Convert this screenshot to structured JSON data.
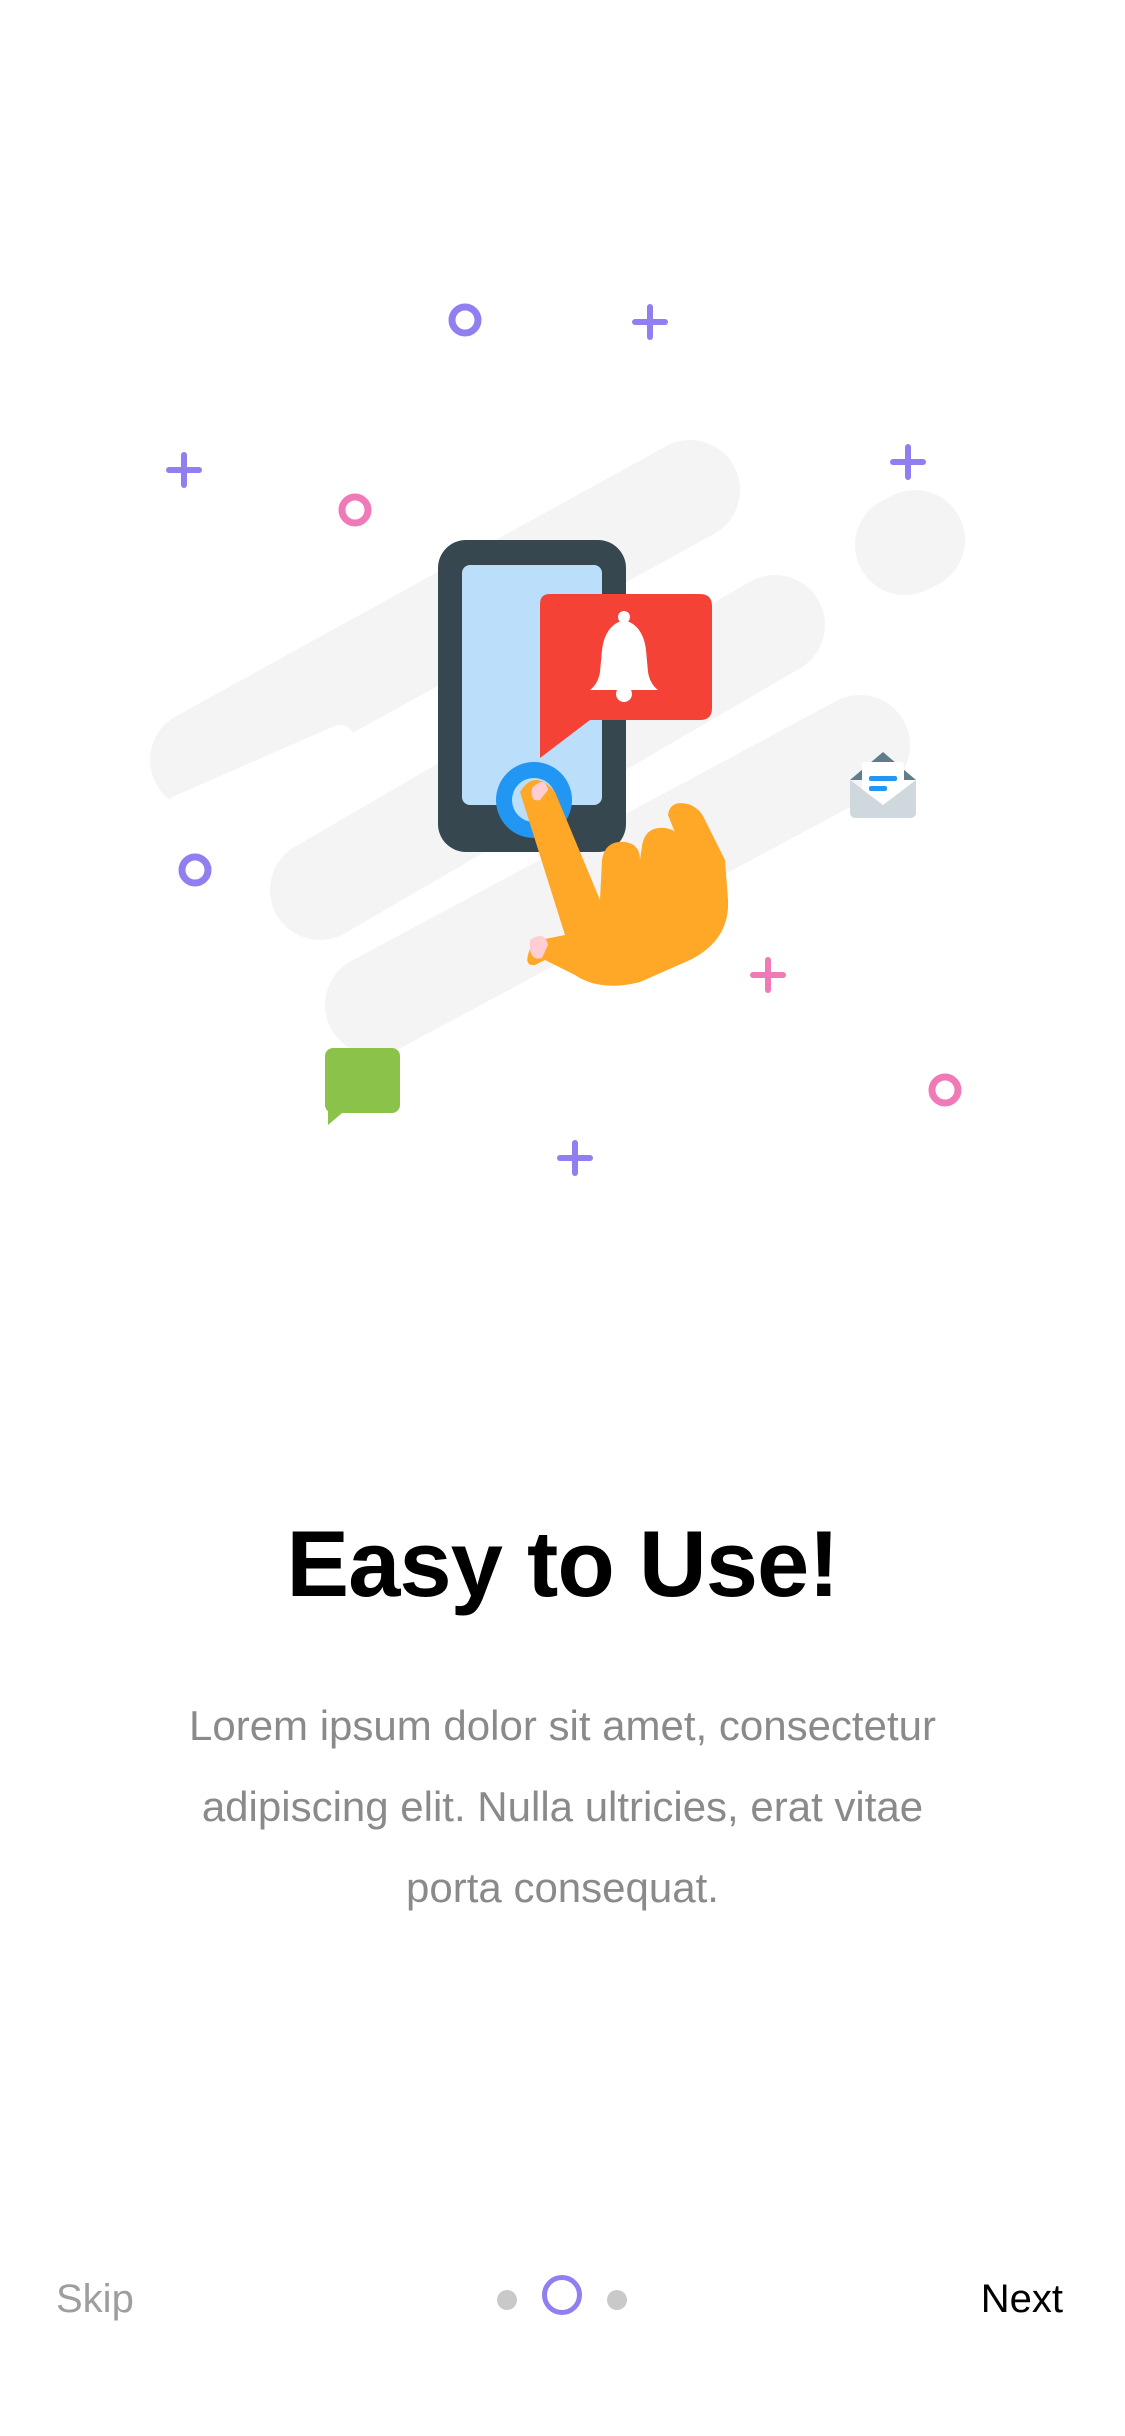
{
  "onboarding": {
    "title": "Easy to Use!",
    "description": "Lorem ipsum dolor sit amet, consectetur adipiscing elit. Nulla ultricies, erat vitae porta consequat.",
    "current_page": 2,
    "total_pages": 3
  },
  "footer": {
    "skip_label": "Skip",
    "next_label": "Next"
  },
  "colors": {
    "accent": "#8f7ff0",
    "pink": "#f07ab8",
    "phone": "#37474f",
    "screen": "#bbdefb",
    "bell_bubble": "#f44336",
    "hand": "#ffa726",
    "tap": "#2196f3",
    "chat": "#8bc34a",
    "text_muted": "#8a8a8a"
  },
  "icons": [
    "phone-icon",
    "bell-icon",
    "hand-pointer-icon",
    "envelope-icon",
    "chat-bubble-icon"
  ]
}
